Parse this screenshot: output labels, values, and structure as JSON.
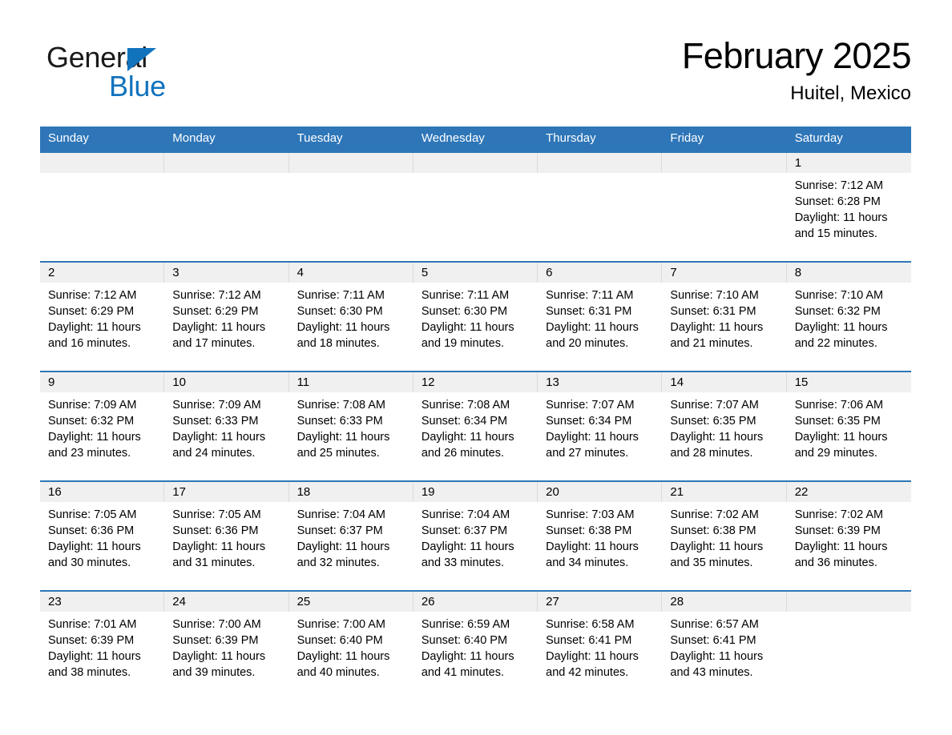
{
  "brand": {
    "name_top": "General",
    "name_bottom": "Blue",
    "accent_color": "#1273bd",
    "triangle_icon": "brand-triangle-icon"
  },
  "header": {
    "month_title": "February 2025",
    "location": "Huitel, Mexico"
  },
  "theme": {
    "header_blue": "#2e76b8",
    "daynum_band_gray": "#f0f0f0",
    "page_background": "#ffffff",
    "text_color": "#000000"
  },
  "weekday_headers": [
    "Sunday",
    "Monday",
    "Tuesday",
    "Wednesday",
    "Thursday",
    "Friday",
    "Saturday"
  ],
  "labels": {
    "sunrise_prefix": "Sunrise:",
    "sunset_prefix": "Sunset:",
    "daylight_prefix": "Daylight:"
  },
  "weeks": [
    [
      {
        "day": "",
        "empty": true,
        "sunrise": "",
        "sunset": "",
        "daylight_line1": "",
        "daylight_line2": ""
      },
      {
        "day": "",
        "empty": true,
        "sunrise": "",
        "sunset": "",
        "daylight_line1": "",
        "daylight_line2": ""
      },
      {
        "day": "",
        "empty": true,
        "sunrise": "",
        "sunset": "",
        "daylight_line1": "",
        "daylight_line2": ""
      },
      {
        "day": "",
        "empty": true,
        "sunrise": "",
        "sunset": "",
        "daylight_line1": "",
        "daylight_line2": ""
      },
      {
        "day": "",
        "empty": true,
        "sunrise": "",
        "sunset": "",
        "daylight_line1": "",
        "daylight_line2": ""
      },
      {
        "day": "",
        "empty": true,
        "sunrise": "",
        "sunset": "",
        "daylight_line1": "",
        "daylight_line2": ""
      },
      {
        "day": "1",
        "empty": false,
        "sunrise": "Sunrise: 7:12 AM",
        "sunset": "Sunset: 6:28 PM",
        "daylight_line1": "Daylight: 11 hours",
        "daylight_line2": "and 15 minutes."
      }
    ],
    [
      {
        "day": "2",
        "empty": false,
        "sunrise": "Sunrise: 7:12 AM",
        "sunset": "Sunset: 6:29 PM",
        "daylight_line1": "Daylight: 11 hours",
        "daylight_line2": "and 16 minutes."
      },
      {
        "day": "3",
        "empty": false,
        "sunrise": "Sunrise: 7:12 AM",
        "sunset": "Sunset: 6:29 PM",
        "daylight_line1": "Daylight: 11 hours",
        "daylight_line2": "and 17 minutes."
      },
      {
        "day": "4",
        "empty": false,
        "sunrise": "Sunrise: 7:11 AM",
        "sunset": "Sunset: 6:30 PM",
        "daylight_line1": "Daylight: 11 hours",
        "daylight_line2": "and 18 minutes."
      },
      {
        "day": "5",
        "empty": false,
        "sunrise": "Sunrise: 7:11 AM",
        "sunset": "Sunset: 6:30 PM",
        "daylight_line1": "Daylight: 11 hours",
        "daylight_line2": "and 19 minutes."
      },
      {
        "day": "6",
        "empty": false,
        "sunrise": "Sunrise: 7:11 AM",
        "sunset": "Sunset: 6:31 PM",
        "daylight_line1": "Daylight: 11 hours",
        "daylight_line2": "and 20 minutes."
      },
      {
        "day": "7",
        "empty": false,
        "sunrise": "Sunrise: 7:10 AM",
        "sunset": "Sunset: 6:31 PM",
        "daylight_line1": "Daylight: 11 hours",
        "daylight_line2": "and 21 minutes."
      },
      {
        "day": "8",
        "empty": false,
        "sunrise": "Sunrise: 7:10 AM",
        "sunset": "Sunset: 6:32 PM",
        "daylight_line1": "Daylight: 11 hours",
        "daylight_line2": "and 22 minutes."
      }
    ],
    [
      {
        "day": "9",
        "empty": false,
        "sunrise": "Sunrise: 7:09 AM",
        "sunset": "Sunset: 6:32 PM",
        "daylight_line1": "Daylight: 11 hours",
        "daylight_line2": "and 23 minutes."
      },
      {
        "day": "10",
        "empty": false,
        "sunrise": "Sunrise: 7:09 AM",
        "sunset": "Sunset: 6:33 PM",
        "daylight_line1": "Daylight: 11 hours",
        "daylight_line2": "and 24 minutes."
      },
      {
        "day": "11",
        "empty": false,
        "sunrise": "Sunrise: 7:08 AM",
        "sunset": "Sunset: 6:33 PM",
        "daylight_line1": "Daylight: 11 hours",
        "daylight_line2": "and 25 minutes."
      },
      {
        "day": "12",
        "empty": false,
        "sunrise": "Sunrise: 7:08 AM",
        "sunset": "Sunset: 6:34 PM",
        "daylight_line1": "Daylight: 11 hours",
        "daylight_line2": "and 26 minutes."
      },
      {
        "day": "13",
        "empty": false,
        "sunrise": "Sunrise: 7:07 AM",
        "sunset": "Sunset: 6:34 PM",
        "daylight_line1": "Daylight: 11 hours",
        "daylight_line2": "and 27 minutes."
      },
      {
        "day": "14",
        "empty": false,
        "sunrise": "Sunrise: 7:07 AM",
        "sunset": "Sunset: 6:35 PM",
        "daylight_line1": "Daylight: 11 hours",
        "daylight_line2": "and 28 minutes."
      },
      {
        "day": "15",
        "empty": false,
        "sunrise": "Sunrise: 7:06 AM",
        "sunset": "Sunset: 6:35 PM",
        "daylight_line1": "Daylight: 11 hours",
        "daylight_line2": "and 29 minutes."
      }
    ],
    [
      {
        "day": "16",
        "empty": false,
        "sunrise": "Sunrise: 7:05 AM",
        "sunset": "Sunset: 6:36 PM",
        "daylight_line1": "Daylight: 11 hours",
        "daylight_line2": "and 30 minutes."
      },
      {
        "day": "17",
        "empty": false,
        "sunrise": "Sunrise: 7:05 AM",
        "sunset": "Sunset: 6:36 PM",
        "daylight_line1": "Daylight: 11 hours",
        "daylight_line2": "and 31 minutes."
      },
      {
        "day": "18",
        "empty": false,
        "sunrise": "Sunrise: 7:04 AM",
        "sunset": "Sunset: 6:37 PM",
        "daylight_line1": "Daylight: 11 hours",
        "daylight_line2": "and 32 minutes."
      },
      {
        "day": "19",
        "empty": false,
        "sunrise": "Sunrise: 7:04 AM",
        "sunset": "Sunset: 6:37 PM",
        "daylight_line1": "Daylight: 11 hours",
        "daylight_line2": "and 33 minutes."
      },
      {
        "day": "20",
        "empty": false,
        "sunrise": "Sunrise: 7:03 AM",
        "sunset": "Sunset: 6:38 PM",
        "daylight_line1": "Daylight: 11 hours",
        "daylight_line2": "and 34 minutes."
      },
      {
        "day": "21",
        "empty": false,
        "sunrise": "Sunrise: 7:02 AM",
        "sunset": "Sunset: 6:38 PM",
        "daylight_line1": "Daylight: 11 hours",
        "daylight_line2": "and 35 minutes."
      },
      {
        "day": "22",
        "empty": false,
        "sunrise": "Sunrise: 7:02 AM",
        "sunset": "Sunset: 6:39 PM",
        "daylight_line1": "Daylight: 11 hours",
        "daylight_line2": "and 36 minutes."
      }
    ],
    [
      {
        "day": "23",
        "empty": false,
        "sunrise": "Sunrise: 7:01 AM",
        "sunset": "Sunset: 6:39 PM",
        "daylight_line1": "Daylight: 11 hours",
        "daylight_line2": "and 38 minutes."
      },
      {
        "day": "24",
        "empty": false,
        "sunrise": "Sunrise: 7:00 AM",
        "sunset": "Sunset: 6:39 PM",
        "daylight_line1": "Daylight: 11 hours",
        "daylight_line2": "and 39 minutes."
      },
      {
        "day": "25",
        "empty": false,
        "sunrise": "Sunrise: 7:00 AM",
        "sunset": "Sunset: 6:40 PM",
        "daylight_line1": "Daylight: 11 hours",
        "daylight_line2": "and 40 minutes."
      },
      {
        "day": "26",
        "empty": false,
        "sunrise": "Sunrise: 6:59 AM",
        "sunset": "Sunset: 6:40 PM",
        "daylight_line1": "Daylight: 11 hours",
        "daylight_line2": "and 41 minutes."
      },
      {
        "day": "27",
        "empty": false,
        "sunrise": "Sunrise: 6:58 AM",
        "sunset": "Sunset: 6:41 PM",
        "daylight_line1": "Daylight: 11 hours",
        "daylight_line2": "and 42 minutes."
      },
      {
        "day": "28",
        "empty": false,
        "sunrise": "Sunrise: 6:57 AM",
        "sunset": "Sunset: 6:41 PM",
        "daylight_line1": "Daylight: 11 hours",
        "daylight_line2": "and 43 minutes."
      },
      {
        "day": "",
        "empty": true,
        "sunrise": "",
        "sunset": "",
        "daylight_line1": "",
        "daylight_line2": ""
      }
    ]
  ]
}
